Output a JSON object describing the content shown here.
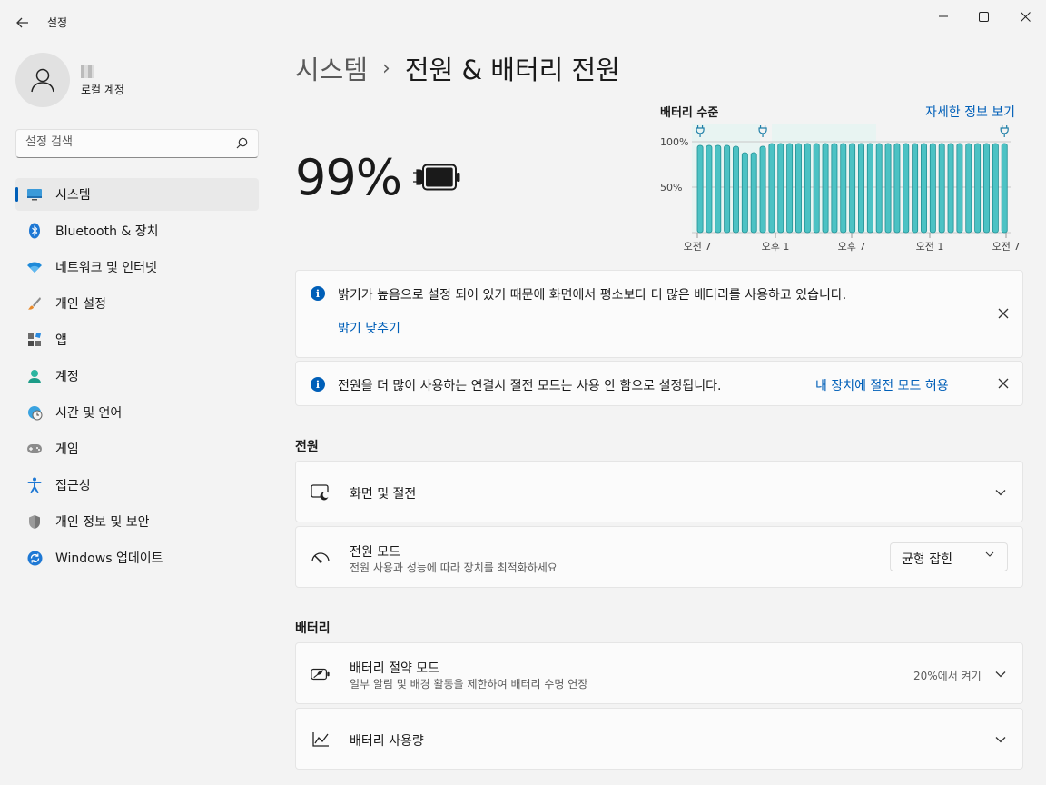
{
  "window": {
    "title": "설정"
  },
  "user": {
    "account_type": "로컬 계정"
  },
  "search": {
    "placeholder": "설정 검색"
  },
  "sidebar": {
    "items": [
      {
        "label": "시스템",
        "icon": "system-icon",
        "active": true
      },
      {
        "label": "Bluetooth & 장치",
        "icon": "bluetooth-icon"
      },
      {
        "label": "네트워크 및 인터넷",
        "icon": "wifi-icon"
      },
      {
        "label": "개인 설정",
        "icon": "brush-icon"
      },
      {
        "label": "앱",
        "icon": "apps-icon"
      },
      {
        "label": "계정",
        "icon": "person-icon"
      },
      {
        "label": "시간 및 언어",
        "icon": "globe-clock-icon"
      },
      {
        "label": "게임",
        "icon": "gamepad-icon"
      },
      {
        "label": "접근성",
        "icon": "accessibility-icon"
      },
      {
        "label": "개인 정보 및 보안",
        "icon": "shield-icon"
      },
      {
        "label": "Windows 업데이트",
        "icon": "update-icon"
      }
    ]
  },
  "breadcrumb": {
    "parent": "시스템",
    "separator": "›",
    "current": "전원 & 배터리 전원"
  },
  "battery": {
    "percent_text": "99%",
    "level": 0.99
  },
  "chart_data": {
    "type": "bar",
    "title": "배터리 수준",
    "link": "자세한 정보 보기",
    "y_ticks": [
      "100%",
      "50%"
    ],
    "x_ticks": [
      "오전 7",
      "오후 1",
      "오후 7",
      "오전 1",
      "오전 7"
    ],
    "ylim": [
      0,
      100
    ],
    "values": [
      96,
      96,
      96,
      96,
      95,
      88,
      88,
      95,
      98,
      98,
      98,
      98,
      98,
      98,
      98,
      98,
      98,
      98,
      98,
      98,
      98,
      98,
      98,
      98,
      98,
      98,
      98,
      98,
      98,
      98,
      98,
      98,
      98,
      98,
      98
    ],
    "charging_markers": [
      0,
      7,
      34
    ],
    "bar_color": "#4cc2c4",
    "grid": true
  },
  "notices": [
    {
      "text": "밝기가 높음으로 설정 되어 있기 때문에 화면에서 평소보다 더 많은 배터리를 사용하고 있습니다.",
      "action": "밝기 낮추기"
    },
    {
      "text": "전원을 더 많이 사용하는 연결시 절전 모드는 사용 안 함으로 설정됩니다.",
      "action": "내 장치에 절전 모드 허용"
    }
  ],
  "power": {
    "section_title": "전원",
    "screen_sleep": {
      "title": "화면 및 절전"
    },
    "power_mode": {
      "title": "전원 모드",
      "subtitle": "전원 사용과 성능에 따라 장치를 최적화하세요",
      "value": "균형 잡힌"
    }
  },
  "battery_section": {
    "section_title": "배터리",
    "saver": {
      "title": "배터리 절약 모드",
      "subtitle": "일부 알림 및 배경 활동을 제한하여 배터리 수명 연장",
      "value": "20%에서 켜기"
    },
    "usage": {
      "title": "배터리 사용량"
    }
  },
  "colors": {
    "accent": "#005fb8",
    "chart_bar": "#4cc2c4",
    "chart_bar_stroke": "#1f8f93"
  }
}
